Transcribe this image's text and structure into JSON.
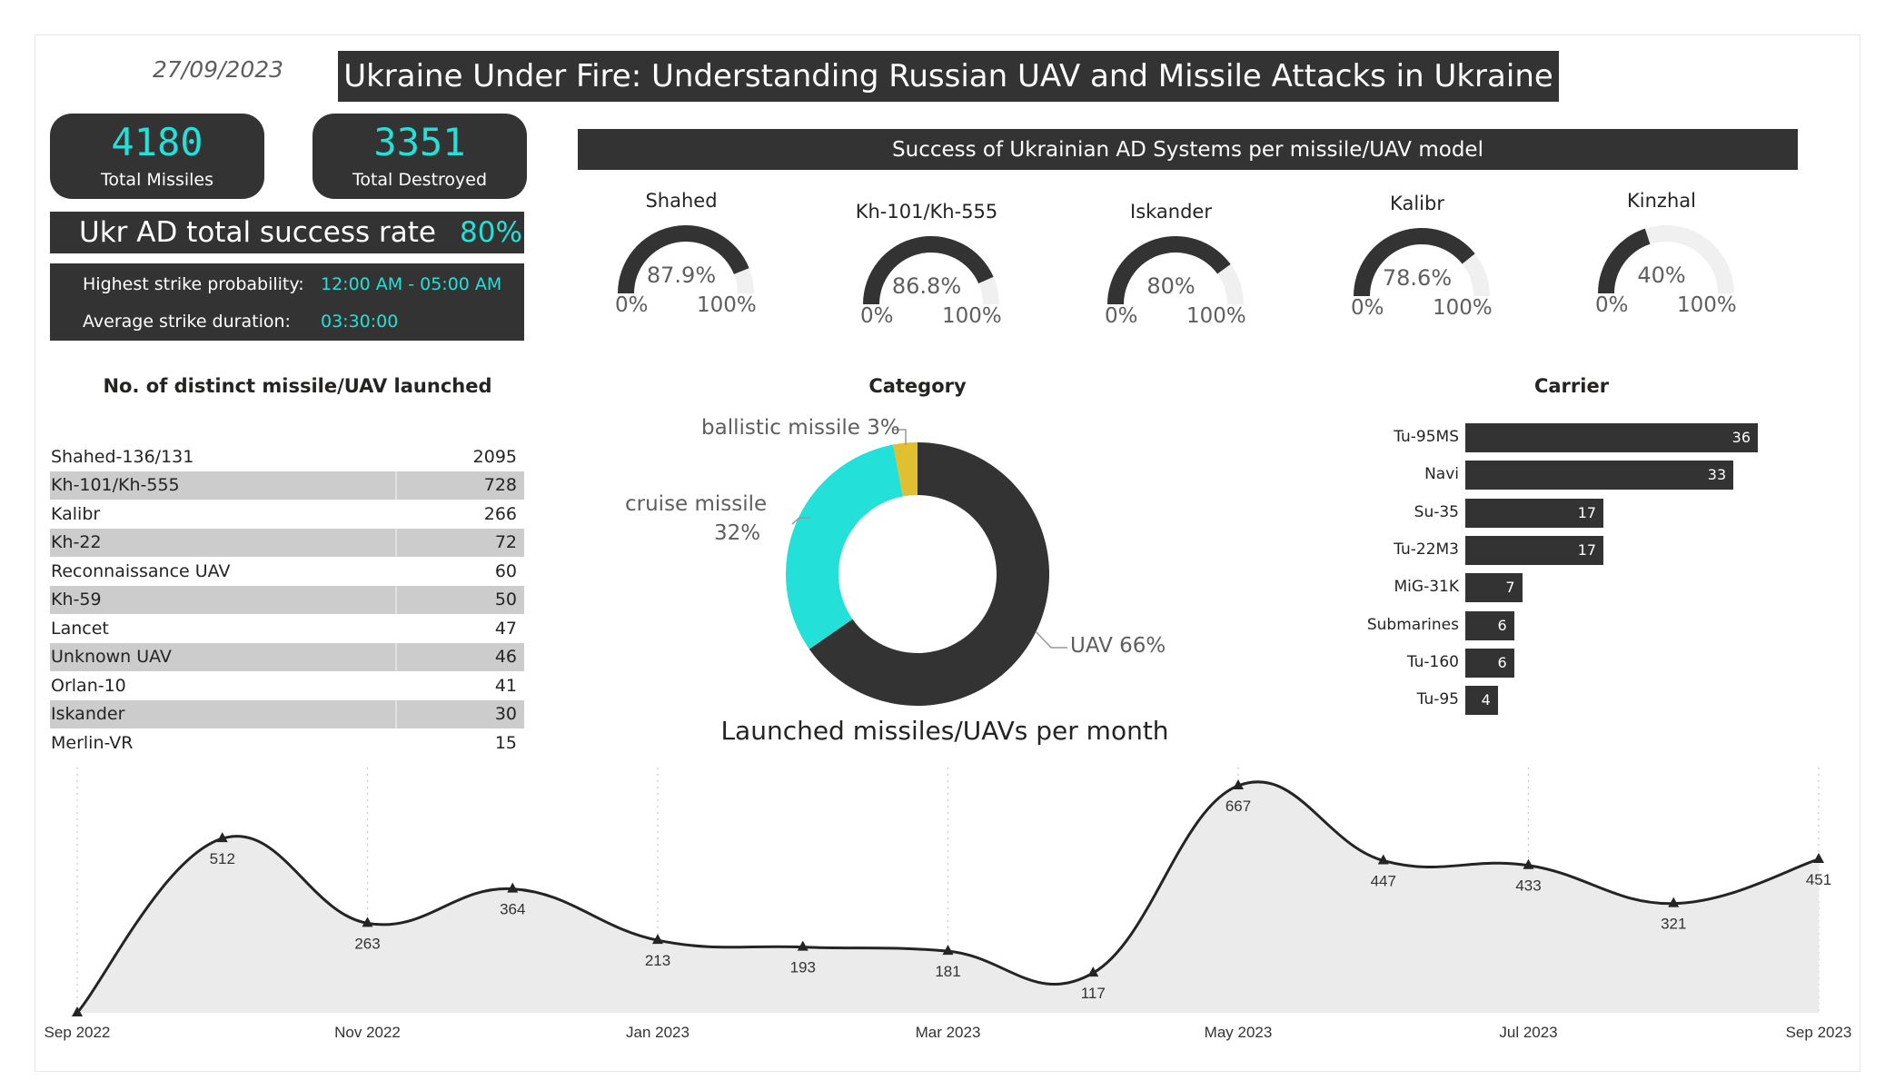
{
  "header": {
    "date": "27/09/2023",
    "title": "Ukraine Under Fire: Understanding Russian UAV and Missile Attacks in Ukraine"
  },
  "kpis": [
    {
      "value": "4180",
      "label": "Total Missiles"
    },
    {
      "value": "3351",
      "label": "Total Destroyed"
    }
  ],
  "success_rate": {
    "label": "Ukr AD total success rate",
    "value": "80%"
  },
  "strike_info": {
    "highest_label": "Highest strike probability:",
    "highest_value": "12:00 AM - 05:00 AM",
    "duration_label": "Average strike duration:",
    "duration_value": "03:30:00"
  },
  "ad_section": {
    "title": "Success of Ukrainian AD Systems per missile/UAV model",
    "gauges": [
      {
        "name": "Shahed",
        "value_label": "87.9%",
        "value": 87.9,
        "min": "0%",
        "max": "100%"
      },
      {
        "name": "Kh-101/Kh-555",
        "value_label": "86.8%",
        "value": 86.8,
        "min": "0%",
        "max": "100%"
      },
      {
        "name": "Iskander",
        "value_label": "80%",
        "value": 80,
        "min": "0%",
        "max": "100%"
      },
      {
        "name": "Kalibr",
        "value_label": "78.6%",
        "value": 78.6,
        "min": "0%",
        "max": "100%"
      },
      {
        "name": "Kinzhal",
        "value_label": "40%",
        "value": 40,
        "min": "0%",
        "max": "100%"
      }
    ]
  },
  "distinct": {
    "title": "No. of distinct missile/UAV launched",
    "rows": [
      {
        "name": "Shahed-136/131",
        "count": "2095"
      },
      {
        "name": "Kh-101/Kh-555",
        "count": "728"
      },
      {
        "name": "Kalibr",
        "count": "266"
      },
      {
        "name": "Kh-22",
        "count": "72"
      },
      {
        "name": "Reconnaissance UAV",
        "count": "60"
      },
      {
        "name": "Kh-59",
        "count": "50"
      },
      {
        "name": "Lancet",
        "count": "47"
      },
      {
        "name": "Unknown UAV",
        "count": "46"
      },
      {
        "name": "Orlan-10",
        "count": "41"
      },
      {
        "name": "Iskander",
        "count": "30"
      },
      {
        "name": "Merlin-VR",
        "count": "15"
      }
    ]
  },
  "category": {
    "title": "Category",
    "labels": {
      "ballistic": "ballistic missile 3%",
      "cruise_line1": "cruise missile",
      "cruise_line2": "32%",
      "uav": "UAV 66%"
    }
  },
  "carrier": {
    "title": "Carrier"
  },
  "line": {
    "title": "Launched missiles/UAVs per month"
  },
  "colors": {
    "dark": "#333333",
    "accent": "#23e0d9",
    "yellow": "#e0c030",
    "track": "#f0f0f0",
    "area": "#ebebeb"
  },
  "chart_data": [
    {
      "type": "pie",
      "title": "Category",
      "categories": [
        "UAV",
        "cruise missile",
        "ballistic missile"
      ],
      "values": [
        66,
        32,
        3
      ]
    },
    {
      "type": "bar",
      "title": "Carrier",
      "orientation": "horizontal",
      "categories": [
        "Tu-95MS",
        "Navi",
        "Su-35",
        "Tu-22M3",
        "MiG-31K",
        "Submarines",
        "Tu-160",
        "Tu-95"
      ],
      "values": [
        36,
        33,
        17,
        17,
        7,
        6,
        6,
        4
      ]
    },
    {
      "type": "area",
      "title": "Launched missiles/UAVs per month",
      "x": [
        "2022-09",
        "2022-10",
        "2022-11",
        "2022-12",
        "2023-01",
        "2023-02",
        "2023-03",
        "2023-04",
        "2023-05",
        "2023-06",
        "2023-07",
        "2023-08",
        "2023-09"
      ],
      "values": [
        0,
        512,
        263,
        364,
        213,
        193,
        181,
        117,
        667,
        447,
        433,
        321,
        451
      ],
      "point_labels": [
        "",
        "512",
        "263",
        "364",
        "213",
        "193",
        "181",
        "117",
        "667",
        "447",
        "433",
        "321",
        "451"
      ],
      "tick_labels": [
        "Sep 2022",
        "Nov 2022",
        "Jan 2023",
        "Mar 2023",
        "May 2023",
        "Jul 2023",
        "Sep 2023"
      ],
      "ylim": [
        0,
        700
      ]
    }
  ]
}
